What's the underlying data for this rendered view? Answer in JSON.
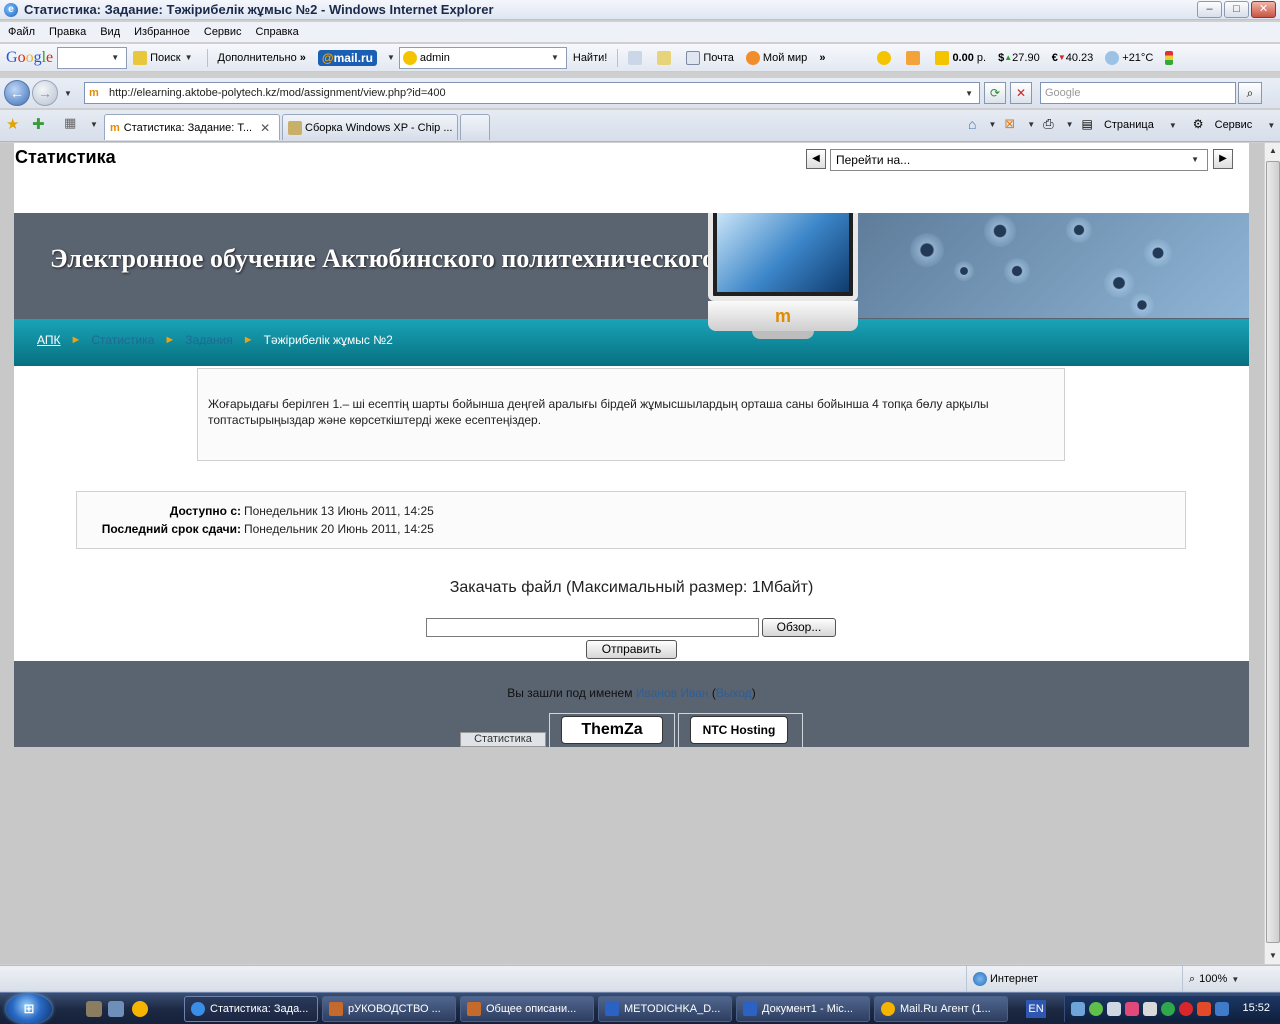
{
  "window": {
    "title": "Статистика: Задание: Тәжірибелік жұмыс №2 - Windows Internet Explorer",
    "min_glyph": "–",
    "max_glyph": "□",
    "close_glyph": "✕"
  },
  "menu": [
    "Файл",
    "Правка",
    "Вид",
    "Избранное",
    "Сервис",
    "Справка"
  ],
  "toolbar": {
    "search_label": "Поиск",
    "more_label": "Дополнительно",
    "mailru_prefix": "@",
    "mailru_brand": "mail.ru",
    "user_value": "admin",
    "find_label": "Найти!",
    "mail_label": "Почта",
    "mymir_label": "Мой мир",
    "balance": "0.00",
    "balance_unit": "р.",
    "usd_label": "$",
    "usd": "27.90",
    "eur_label": "€",
    "eur": "40.23",
    "weather": "+21°C"
  },
  "address": {
    "url": "http://elearning.aktobe-polytech.kz/mod/assignment/view.php?id=400",
    "search_placeholder": "Google"
  },
  "tabs": [
    {
      "label": "Статистика: Задание: Т...",
      "active": true
    },
    {
      "label": "Сборка Windows XP - Chip ...",
      "active": false
    }
  ],
  "commandbar": {
    "page_label": "Страница",
    "tools_label": "Сервис"
  },
  "page": {
    "title": "Статистика",
    "jump_placeholder": "Перейти на...",
    "prev_glyph": "◀",
    "next_glyph": "▶",
    "banner_title": "Электронное обучение Актюбинского политехнического колледжа",
    "breadcrumb": {
      "home": "АПК",
      "course": "Статистика",
      "section": "Задания",
      "current": "Тәжірибелік жұмыс №2",
      "separator": "►"
    },
    "intro": "Жоғарыдағы берілген 1.– ші есептің шарты бойынша деңгей аралығы бірдей жұмысшылардың орташа саны бойынша 4 топқа бөлу арқылы топтастырыңыздар және көрсеткіштерді жеке есептеңіздер.",
    "dates": {
      "available_label": "Доступно с:",
      "available_value": "Понедельник 13 Июнь 2011, 14:25",
      "due_label": "Последний срок сдачи:",
      "due_value": "Понедельник 20 Июнь 2011, 14:25"
    },
    "upload": {
      "heading": "Закачать файл (Максимальный размер: 1Мбайт)",
      "browse_label": "Обзор...",
      "submit_label": "Отправить"
    },
    "footer": {
      "logged_in_prefix": "Вы зашли под именем",
      "user_name": "Иванов Иван",
      "logout_label": "Выход",
      "home_tab": "Статистика",
      "themza": "ThemZa",
      "ntc": "NTC Hosting"
    }
  },
  "statusbar": {
    "zone": "Интернет",
    "zoom": "100%"
  },
  "taskbar": {
    "start_label": "⊞",
    "items": [
      {
        "label": "Статистика: Зада...",
        "active": true
      },
      {
        "label": "рУКОВОДСТВО ...",
        "active": false
      },
      {
        "label": "Общее описани...",
        "active": false
      },
      {
        "label": "METODICHKA_D...",
        "active": false
      },
      {
        "label": "Документ1 - Mic...",
        "active": false
      },
      {
        "label": "Mail.Ru Агент (1...",
        "active": false
      }
    ],
    "lang": "EN",
    "clock": "15:52"
  },
  "colors": {
    "banner_bg": "#5a6370",
    "teal_bar": "#0b8a9c",
    "breadcrumb_arrow": "#f2a20c",
    "link_blue": "#2b5f9a"
  }
}
